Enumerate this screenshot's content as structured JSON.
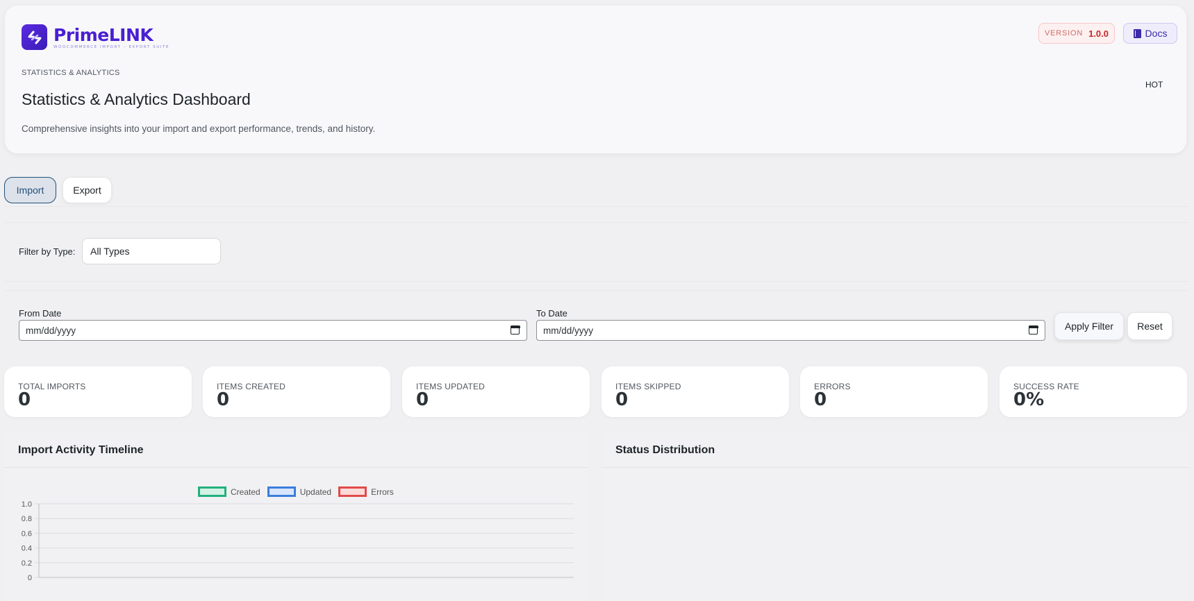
{
  "header": {
    "brand_name": "PrimeLINK",
    "brand_tagline": "WOOCOMMERCE IMPORT – EXPORT SUITE",
    "version_label": "VERSION",
    "version_value": "1.0.0",
    "docs_label": "Docs",
    "eyebrow": "STATISTICS & ANALYTICS",
    "title": "Statistics & Analytics Dashboard",
    "hot": "HOT",
    "description": "Comprehensive insights into your import and export performance, trends, and history."
  },
  "tabs": [
    {
      "label": "Import",
      "active": true
    },
    {
      "label": "Export",
      "active": false
    }
  ],
  "filters": {
    "type_label": "Filter by Type:",
    "type_value": "All Types",
    "from_label": "From Date",
    "from_value": "mm/dd/yyyy",
    "to_label": "To Date",
    "to_value": "mm/dd/yyyy",
    "apply_label": "Apply Filter",
    "reset_label": "Reset"
  },
  "stats": [
    {
      "label": "TOTAL IMPORTS",
      "value": "0"
    },
    {
      "label": "ITEMS CREATED",
      "value": "0"
    },
    {
      "label": "ITEMS UPDATED",
      "value": "0"
    },
    {
      "label": "ITEMS SKIPPED",
      "value": "0"
    },
    {
      "label": "ERRORS",
      "value": "0"
    },
    {
      "label": "SUCCESS RATE",
      "value": "0%"
    }
  ],
  "panels": {
    "timeline_title": "Import Activity Timeline",
    "status_title": "Status Distribution"
  },
  "chart_data": {
    "type": "line",
    "title": "",
    "xlabel": "",
    "ylabel": "",
    "ylim": [
      0,
      1.0
    ],
    "yticks": [
      "1.0",
      "0.8",
      "0.6",
      "0.4",
      "0.2",
      "0"
    ],
    "x": [],
    "grid": true,
    "legend_position": "top",
    "series": [
      {
        "name": "Created",
        "values": [],
        "color": "#22b07d"
      },
      {
        "name": "Updated",
        "values": [],
        "color": "#3b7ddd"
      },
      {
        "name": "Errors",
        "values": [],
        "color": "#e04a4a"
      }
    ]
  },
  "colors": {
    "brand": "#4a1fd1",
    "tab_active_border": "#1f4e79",
    "version_accent": "#c62828"
  },
  "icons": {
    "logo": "arrows-exchange-icon",
    "docs": "book-icon",
    "date": "calendar-icon"
  }
}
